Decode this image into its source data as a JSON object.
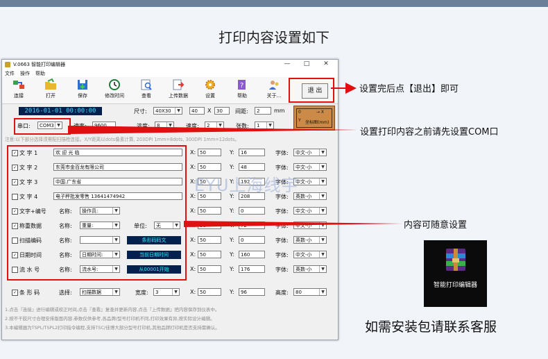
{
  "heading": "打印内容设置如下",
  "window": {
    "title": "V.0663 智能打印编辑器",
    "controls": [
      "—",
      "□",
      "✕"
    ],
    "menu": [
      "文件",
      "操作",
      "帮助"
    ],
    "toolbar": [
      {
        "label": "连接",
        "icon": "connect-icon"
      },
      {
        "label": "打开",
        "icon": "folder-icon"
      },
      {
        "label": "保存",
        "icon": "save-icon"
      },
      {
        "label": "修改时间",
        "icon": "clock-icon"
      },
      {
        "label": "查看",
        "icon": "view-icon"
      },
      {
        "label": "上传数据",
        "icon": "upload-icon"
      },
      {
        "label": "设置",
        "icon": "gear-icon"
      },
      {
        "label": "帮助",
        "icon": "help-icon"
      },
      {
        "label": "关于...",
        "icon": "about-icon"
      }
    ],
    "exit_label": "退 出",
    "datetime": "2016-01-01 00:00:00",
    "size_label": "尺寸:",
    "size_value": "40X30",
    "width_value": "40",
    "x_sep": "X",
    "height_value": "30",
    "gap_label": "间距:",
    "gap_value": "2",
    "gap_unit": "mm",
    "port_label": "串口:",
    "port_value": "COM3",
    "baud_label": "速率:",
    "baud_value": "9600",
    "density_label": "浓度:",
    "density_value": "8",
    "speed_label": "速度:",
    "speed_value": "2",
    "copies_label": "张数:",
    "copies_value": "1",
    "preview": {
      "origin": "0",
      "x_axis": "→ X",
      "y_axis": "Y",
      "caption": "坐标图(mm)"
    },
    "notice": "注意:以下部分选择须需配扫描枪连接。X/Y距离以dots像素计算, 203DPI 1mm=8dots, 300DPI 1mm=12dots。",
    "rows": [
      {
        "checked": true,
        "label": "文 字 1",
        "text": "欢 迎 光 临",
        "x": "50",
        "y": "16",
        "font": "中文-小"
      },
      {
        "checked": true,
        "label": "文 字 2",
        "text": "东莞市金百龙有限公司",
        "x": "50",
        "y": "48",
        "font": "中文-小"
      },
      {
        "checked": true,
        "label": "文 字 3",
        "text": "中国.广东省",
        "x": "50",
        "y": "192",
        "font": "中文-小"
      },
      {
        "checked": false,
        "label": "文 字 4",
        "text": "电子秤批发零售 13641474942",
        "x": "50",
        "y": "208",
        "font": "英数-小"
      },
      {
        "checked": true,
        "label": "文字+编号",
        "name_label": "名称:",
        "name_value": "操作员:",
        "x": "50",
        "y": "0",
        "font": "中文-小"
      },
      {
        "checked": true,
        "label": "称重数据",
        "name_label": "名称:",
        "name_value": "重量:",
        "unit_label": "单位:",
        "unit_value": "无",
        "x": "50",
        "y": "72",
        "font": "中文-小"
      },
      {
        "checked": false,
        "label": "扫描编码",
        "name_label": "名称:",
        "name_value": "",
        "button": "条形码码文",
        "x": "50",
        "y": "0",
        "font": "英数-小"
      },
      {
        "checked": true,
        "label": "日期时间",
        "name_label": "名称:",
        "name_value": "日期时间:",
        "button": "当前日期时间",
        "x": "50",
        "y": "160",
        "font": "中文-小"
      },
      {
        "checked": false,
        "label": "流 水 号",
        "name_label": "名称:",
        "name_value": "流水号:",
        "button": "从00001开始",
        "x": "50",
        "y": "176",
        "font": "英数-小"
      }
    ],
    "x_label": "X:",
    "y_label": "Y:",
    "font_label": "字体:",
    "barcode": {
      "checked": true,
      "label": "条 形 码",
      "select_label": "选择:",
      "select_value": "扫描数据",
      "width_label": "宽度:",
      "width_value": "3",
      "x": "50",
      "y": "96",
      "height_label": "高度:",
      "height_value": "80"
    },
    "footer": [
      "1.点击『连接』进行编辑或校正时间,点击『查看』复查并更新内容,点击『上传数据』把内容保存到仪表中。",
      "2.按不干胶尺寸合理安排版面内容,参数仅供参考,各品牌/型号打印机不同,打印效果有异,按实际设计编辑。",
      "3.本编辑器为TSPL/TSPL2打印指令编程,支持TSC/佳博大部分型号打印机,其他品牌打印机是否支持需确认。"
    ]
  },
  "annotations": {
    "exit_note": "设置完后点【退出】即可",
    "com_note": "设置打印内容之前请先设置COM口",
    "content_note": "内容可随意设置"
  },
  "watermark": "EYU上海线宇",
  "logo_label": "智能打印编辑器",
  "contact": "如需安装包请联系客服",
  "colors": {
    "red": "#e01010",
    "clock_bg": "#04204d",
    "clock_fg": "#3fd6ff",
    "preview_bg": "#cc8a48"
  }
}
